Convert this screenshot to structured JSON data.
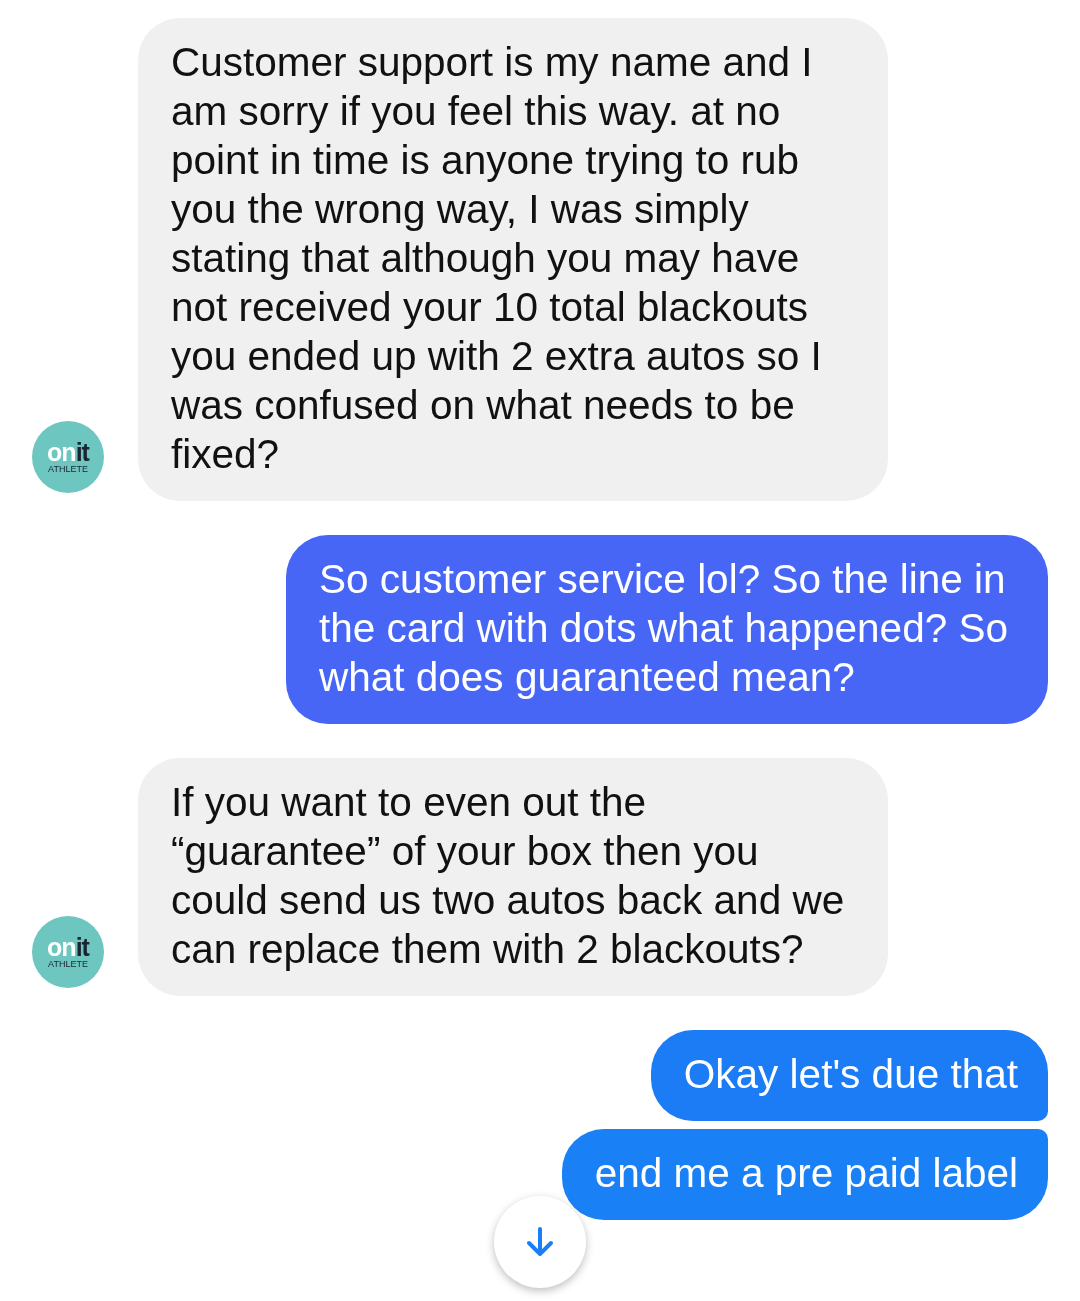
{
  "messages": [
    {
      "kind": "received",
      "text": "Customer support is my name and I am sorry if you feel this way. at no point in time is anyone trying to rub you the wrong way, I was simply stating that although you may have not received your 10 total blackouts you ended up with 2 extra autos so I was confused on what needs to be fixed?",
      "avatar": {
        "logo": "on",
        "logo_bold": "it",
        "tagline": "ATHLETE"
      }
    },
    {
      "kind": "sent",
      "text": "So customer service lol?  So the line in the card with dots what happened? So what does guaranteed mean?",
      "color": "#4766f6"
    },
    {
      "kind": "received",
      "text": "If you want to even out the “guarantee” of your box then you could send us two autos back and we can replace them with 2 blackouts?",
      "avatar": {
        "logo": "on",
        "logo_bold": "it",
        "tagline": "ATHLETE"
      }
    },
    {
      "kind": "sent",
      "text": "Okay let's due that",
      "color": "#1b7cf5"
    },
    {
      "kind": "sent",
      "text": "end me a pre paid label",
      "color": "#1a80f5"
    }
  ]
}
